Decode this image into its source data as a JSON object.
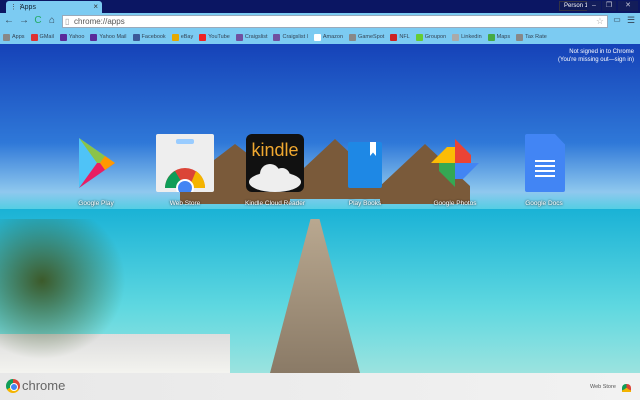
{
  "window": {
    "tab_title": "Apps",
    "profile": "Person 1",
    "minimize": "–",
    "restore": "❐",
    "close": "✕"
  },
  "toolbar": {
    "back": "←",
    "forward": "→",
    "reload": "C",
    "home": "⌂",
    "url": "chrome://apps",
    "star": "☆",
    "menu": "☰"
  },
  "bookmarks": [
    {
      "label": "Apps",
      "color": "#888"
    },
    {
      "label": "GMail",
      "color": "#d33"
    },
    {
      "label": "Yahoo",
      "color": "#5a2a9a"
    },
    {
      "label": "Yahoo Mail",
      "color": "#5a2a9a"
    },
    {
      "label": "Facebook",
      "color": "#3b5998"
    },
    {
      "label": "eBay",
      "color": "#e5a800"
    },
    {
      "label": "YouTube",
      "color": "#e22"
    },
    {
      "label": "Craigslist",
      "color": "#7050a0"
    },
    {
      "label": "Craigslist l",
      "color": "#7050a0"
    },
    {
      "label": "Amazon",
      "color": "#fff"
    },
    {
      "label": "GameSpot",
      "color": "#888"
    },
    {
      "label": "NFL",
      "color": "#c22"
    },
    {
      "label": "Groupon",
      "color": "#6c3"
    },
    {
      "label": "Linkedin",
      "color": "#aaa"
    },
    {
      "label": "Maps",
      "color": "#4a4"
    },
    {
      "label": "Tax Rate",
      "color": "#888"
    }
  ],
  "signin": {
    "line1": "Not signed in to Chrome",
    "line2": "(You're missing out—sign in)"
  },
  "apps": [
    {
      "label": "Google Play"
    },
    {
      "label": "Web Store"
    },
    {
      "label": "Kindle Cloud Reader",
      "icon_text": "kindle"
    },
    {
      "label": "Play Books"
    },
    {
      "label": "Google Photos"
    },
    {
      "label": "Google Docs"
    }
  ],
  "footer": {
    "brand": "chrome",
    "webstore": "Web Store"
  }
}
